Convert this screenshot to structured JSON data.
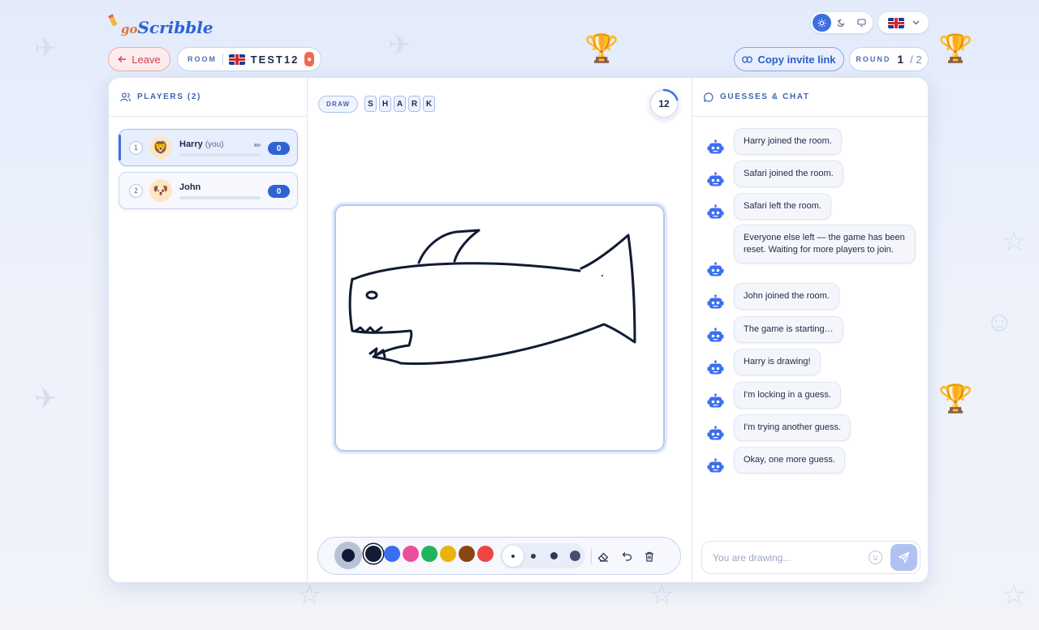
{
  "app": {
    "logo_prefix": "go",
    "logo_name": "Scribble"
  },
  "header": {
    "leave_label": "Leave",
    "room_label": "ROOM",
    "room_code": "TEST12",
    "invite_label": "Copy invite link",
    "round_label": "ROUND",
    "round_current": "1",
    "round_total": "/ 2",
    "theme_options": [
      "light-icon",
      "moon-icon",
      "monitor-icon"
    ],
    "theme_selected": "light",
    "language_flag": "uk-flag"
  },
  "players": {
    "heading": "PLAYERS (2)",
    "list": [
      {
        "rank": "1",
        "name": "Harry",
        "you_tag": "(you)",
        "score": "0",
        "avatar": "lion-avatar",
        "drawing": true
      },
      {
        "rank": "2",
        "name": "John",
        "you_tag": "",
        "score": "0",
        "avatar": "dog-avatar",
        "drawing": false
      }
    ]
  },
  "game": {
    "mode_tag": "DRAW",
    "word_letters": [
      "S",
      "H",
      "A",
      "R",
      "K"
    ],
    "timer": "12",
    "timer_progress": 0.2
  },
  "toolbar": {
    "current_color": "#111b33",
    "colors": [
      "#111b33",
      "#3b6ef0",
      "#ec4f9a",
      "#22b45a",
      "#eab308",
      "#8b4513",
      "#ef4444"
    ],
    "selected_color": "#111b33",
    "brush_sizes": [
      "small",
      "medium",
      "large",
      "xlarge"
    ],
    "selected_size": "small"
  },
  "chat": {
    "heading": "GUESSES & CHAT",
    "messages": [
      "Harry joined the room.",
      "Safari joined the room.",
      "Safari left the room.",
      "Everyone else left — the game has been reset. Waiting for more players to join.",
      "John joined the room.",
      "The game is starting…",
      "Harry is drawing!",
      "I'm locking in a guess.",
      "I'm trying another guess.",
      "Okay, one more guess."
    ],
    "input_placeholder": "You are drawing..."
  },
  "colors": {
    "accent": "#3d6fe0",
    "danger": "#d3404a",
    "text": "#1e2a4a"
  }
}
